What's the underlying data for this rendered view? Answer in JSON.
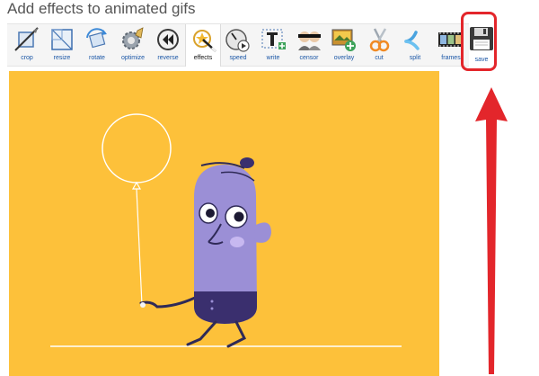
{
  "page": {
    "title": "Add effects to animated gifs"
  },
  "toolbar": {
    "tools": [
      {
        "label": "crop",
        "icon": "crop-icon"
      },
      {
        "label": "resize",
        "icon": "resize-icon"
      },
      {
        "label": "rotate",
        "icon": "rotate-icon"
      },
      {
        "label": "optimize",
        "icon": "optimize-icon"
      },
      {
        "label": "reverse",
        "icon": "reverse-icon"
      },
      {
        "label": "effects",
        "icon": "effects-icon",
        "active": true
      },
      {
        "label": "speed",
        "icon": "speed-icon"
      },
      {
        "label": "write",
        "icon": "write-icon"
      },
      {
        "label": "censor",
        "icon": "censor-icon"
      },
      {
        "label": "overlay",
        "icon": "overlay-icon"
      },
      {
        "label": "cut",
        "icon": "cut-icon"
      },
      {
        "label": "split",
        "icon": "split-icon"
      },
      {
        "label": "frames",
        "icon": "frames-icon"
      }
    ],
    "save": {
      "label": "save",
      "icon": "floppy-disk-icon"
    }
  },
  "colors": {
    "canvas_background": "#fdc13a",
    "highlight": "#e3262b",
    "link": "#1a56a6",
    "character_body": "#9b8fd6"
  }
}
